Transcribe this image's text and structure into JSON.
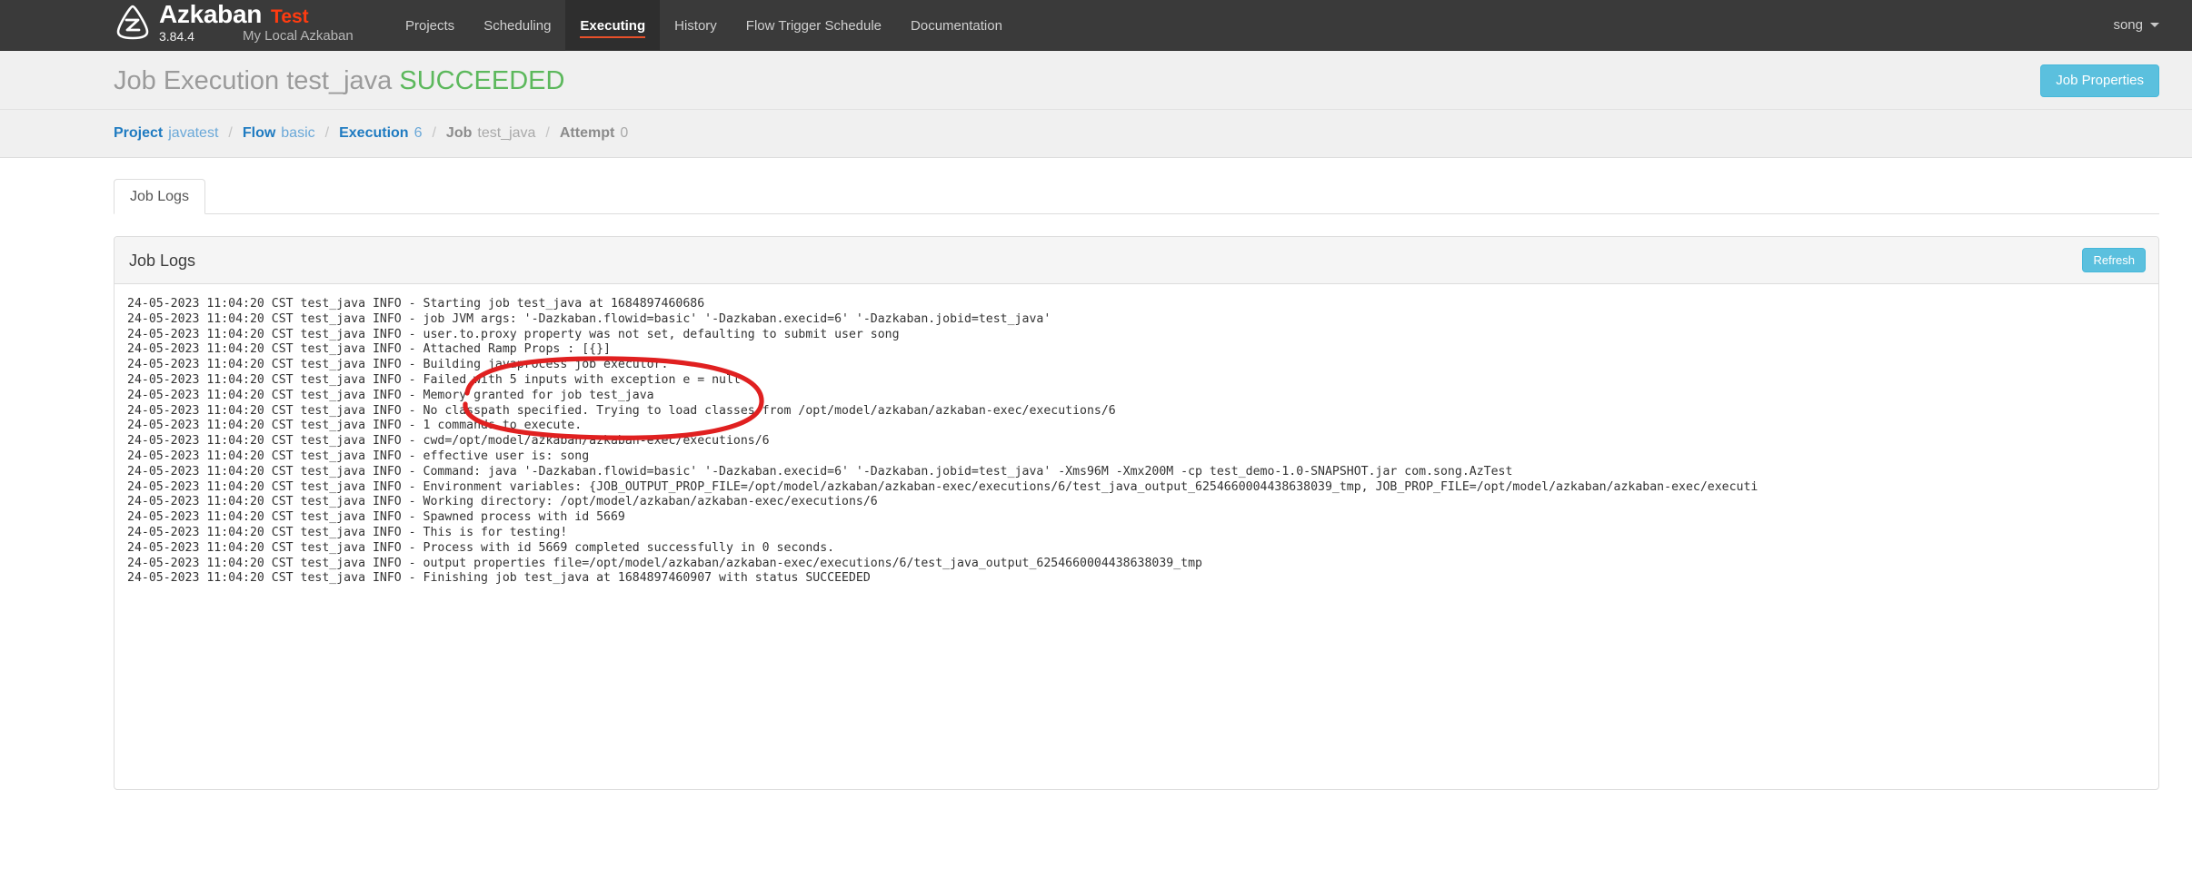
{
  "navbar": {
    "logo_icon": "azkaban-logo-icon",
    "brand_name": "Azkaban",
    "brand_tag": "Test",
    "version": "3.84.4",
    "subtitle": "My Local Azkaban",
    "links": [
      {
        "label": "Projects",
        "active": false
      },
      {
        "label": "Scheduling",
        "active": false
      },
      {
        "label": "Executing",
        "active": true
      },
      {
        "label": "History",
        "active": false
      },
      {
        "label": "Flow Trigger Schedule",
        "active": false
      },
      {
        "label": "Documentation",
        "active": false
      }
    ],
    "user": "song",
    "user_caret_icon": "caret-down-icon"
  },
  "header": {
    "title_prefix": "Job Execution test_java",
    "status": "SUCCEEDED",
    "status_color": "#5cb85c",
    "job_properties_label": "Job Properties",
    "accent_color": "#5bc0de"
  },
  "breadcrumb": [
    {
      "key": "Project",
      "value": "javatest",
      "link": true
    },
    {
      "key": "Flow",
      "value": "basic",
      "link": true
    },
    {
      "key": "Execution",
      "value": "6",
      "link": true
    },
    {
      "key": "Job",
      "value": "test_java",
      "link": false
    },
    {
      "key": "Attempt",
      "value": "0",
      "link": false
    }
  ],
  "breadcrumb_separator": "/",
  "tabs": [
    {
      "label": "Job Logs",
      "active": true
    }
  ],
  "panel": {
    "title": "Job Logs",
    "refresh_label": "Refresh"
  },
  "logs": [
    "24-05-2023 11:04:20 CST test_java INFO - Starting job test_java at 1684897460686",
    "24-05-2023 11:04:20 CST test_java INFO - job JVM args: '-Dazkaban.flowid=basic' '-Dazkaban.execid=6' '-Dazkaban.jobid=test_java'",
    "24-05-2023 11:04:20 CST test_java INFO - user.to.proxy property was not set, defaulting to submit user song",
    "24-05-2023 11:04:20 CST test_java INFO - Attached Ramp Props : [{}]",
    "24-05-2023 11:04:20 CST test_java INFO - Building javaprocess job executor.",
    "24-05-2023 11:04:20 CST test_java INFO - Failed with 5 inputs with exception e = null",
    "24-05-2023 11:04:20 CST test_java INFO - Memory granted for job test_java",
    "24-05-2023 11:04:20 CST test_java INFO - No classpath specified. Trying to load classes from /opt/model/azkaban/azkaban-exec/executions/6",
    "24-05-2023 11:04:20 CST test_java INFO - 1 commands to execute.",
    "24-05-2023 11:04:20 CST test_java INFO - cwd=/opt/model/azkaban/azkaban-exec/executions/6",
    "24-05-2023 11:04:20 CST test_java INFO - effective user is: song",
    "24-05-2023 11:04:20 CST test_java INFO - Command: java '-Dazkaban.flowid=basic' '-Dazkaban.execid=6' '-Dazkaban.jobid=test_java' -Xms96M -Xmx200M -cp test_demo-1.0-SNAPSHOT.jar com.song.AzTest",
    "24-05-2023 11:04:20 CST test_java INFO - Environment variables: {JOB_OUTPUT_PROP_FILE=/opt/model/azkaban/azkaban-exec/executions/6/test_java_output_6254660004438638039_tmp, JOB_PROP_FILE=/opt/model/azkaban/azkaban-exec/executi",
    "24-05-2023 11:04:20 CST test_java INFO - Working directory: /opt/model/azkaban/azkaban-exec/executions/6",
    "24-05-2023 11:04:20 CST test_java INFO - Spawned process with id 5669",
    "24-05-2023 11:04:20 CST test_java INFO - This is for testing!",
    "24-05-2023 11:04:20 CST test_java INFO - Process with id 5669 completed successfully in 0 seconds.",
    "24-05-2023 11:04:20 CST test_java INFO - output properties file=/opt/model/azkaban/azkaban-exec/executions/6/test_java_output_6254660004438638039_tmp",
    "24-05-2023 11:04:20 CST test_java INFO - Finishing job test_java at 1684897460907 with status SUCCEEDED"
  ],
  "annotation": {
    "type": "hand-drawn-ellipse",
    "color": "#e02020"
  }
}
